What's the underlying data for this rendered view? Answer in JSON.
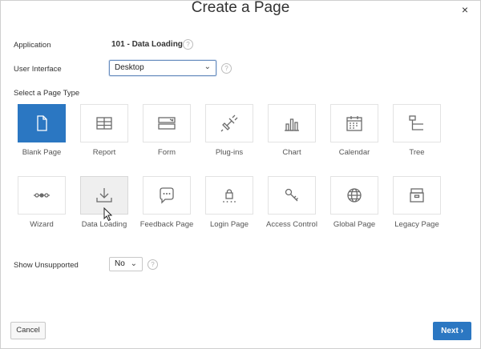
{
  "dialog": {
    "title": "Create a Page",
    "close_glyph": "×"
  },
  "form": {
    "application_label": "Application",
    "application_value": "101 - Data Loading",
    "ui_label": "User Interface",
    "ui_value": "Desktop",
    "page_type_label": "Select a Page Type",
    "show_unsupported_label": "Show Unsupported",
    "show_unsupported_value": "No",
    "help_glyph": "?"
  },
  "page_types": [
    {
      "label": "Blank Page",
      "icon": "blank-page-icon",
      "state": "selected"
    },
    {
      "label": "Report",
      "icon": "report-icon",
      "state": ""
    },
    {
      "label": "Form",
      "icon": "form-icon",
      "state": ""
    },
    {
      "label": "Plug-ins",
      "icon": "plug-icon",
      "state": ""
    },
    {
      "label": "Chart",
      "icon": "chart-icon",
      "state": ""
    },
    {
      "label": "Calendar",
      "icon": "calendar-icon",
      "state": ""
    },
    {
      "label": "Tree",
      "icon": "tree-icon",
      "state": ""
    },
    {
      "label": "Wizard",
      "icon": "wizard-icon",
      "state": ""
    },
    {
      "label": "Data Loading",
      "icon": "download-icon",
      "state": "hover"
    },
    {
      "label": "Feedback Page",
      "icon": "chat-bubble-icon",
      "state": ""
    },
    {
      "label": "Login Page",
      "icon": "lock-icon",
      "state": ""
    },
    {
      "label": "Access Control",
      "icon": "key-icon",
      "state": ""
    },
    {
      "label": "Global Page",
      "icon": "globe-icon",
      "state": ""
    },
    {
      "label": "Legacy Page",
      "icon": "archive-box-icon",
      "state": ""
    }
  ],
  "buttons": {
    "cancel": "Cancel",
    "next": "Next",
    "next_glyph": "›"
  },
  "colors": {
    "accent": "#2b77c2",
    "hover_tile": "#efefef"
  }
}
